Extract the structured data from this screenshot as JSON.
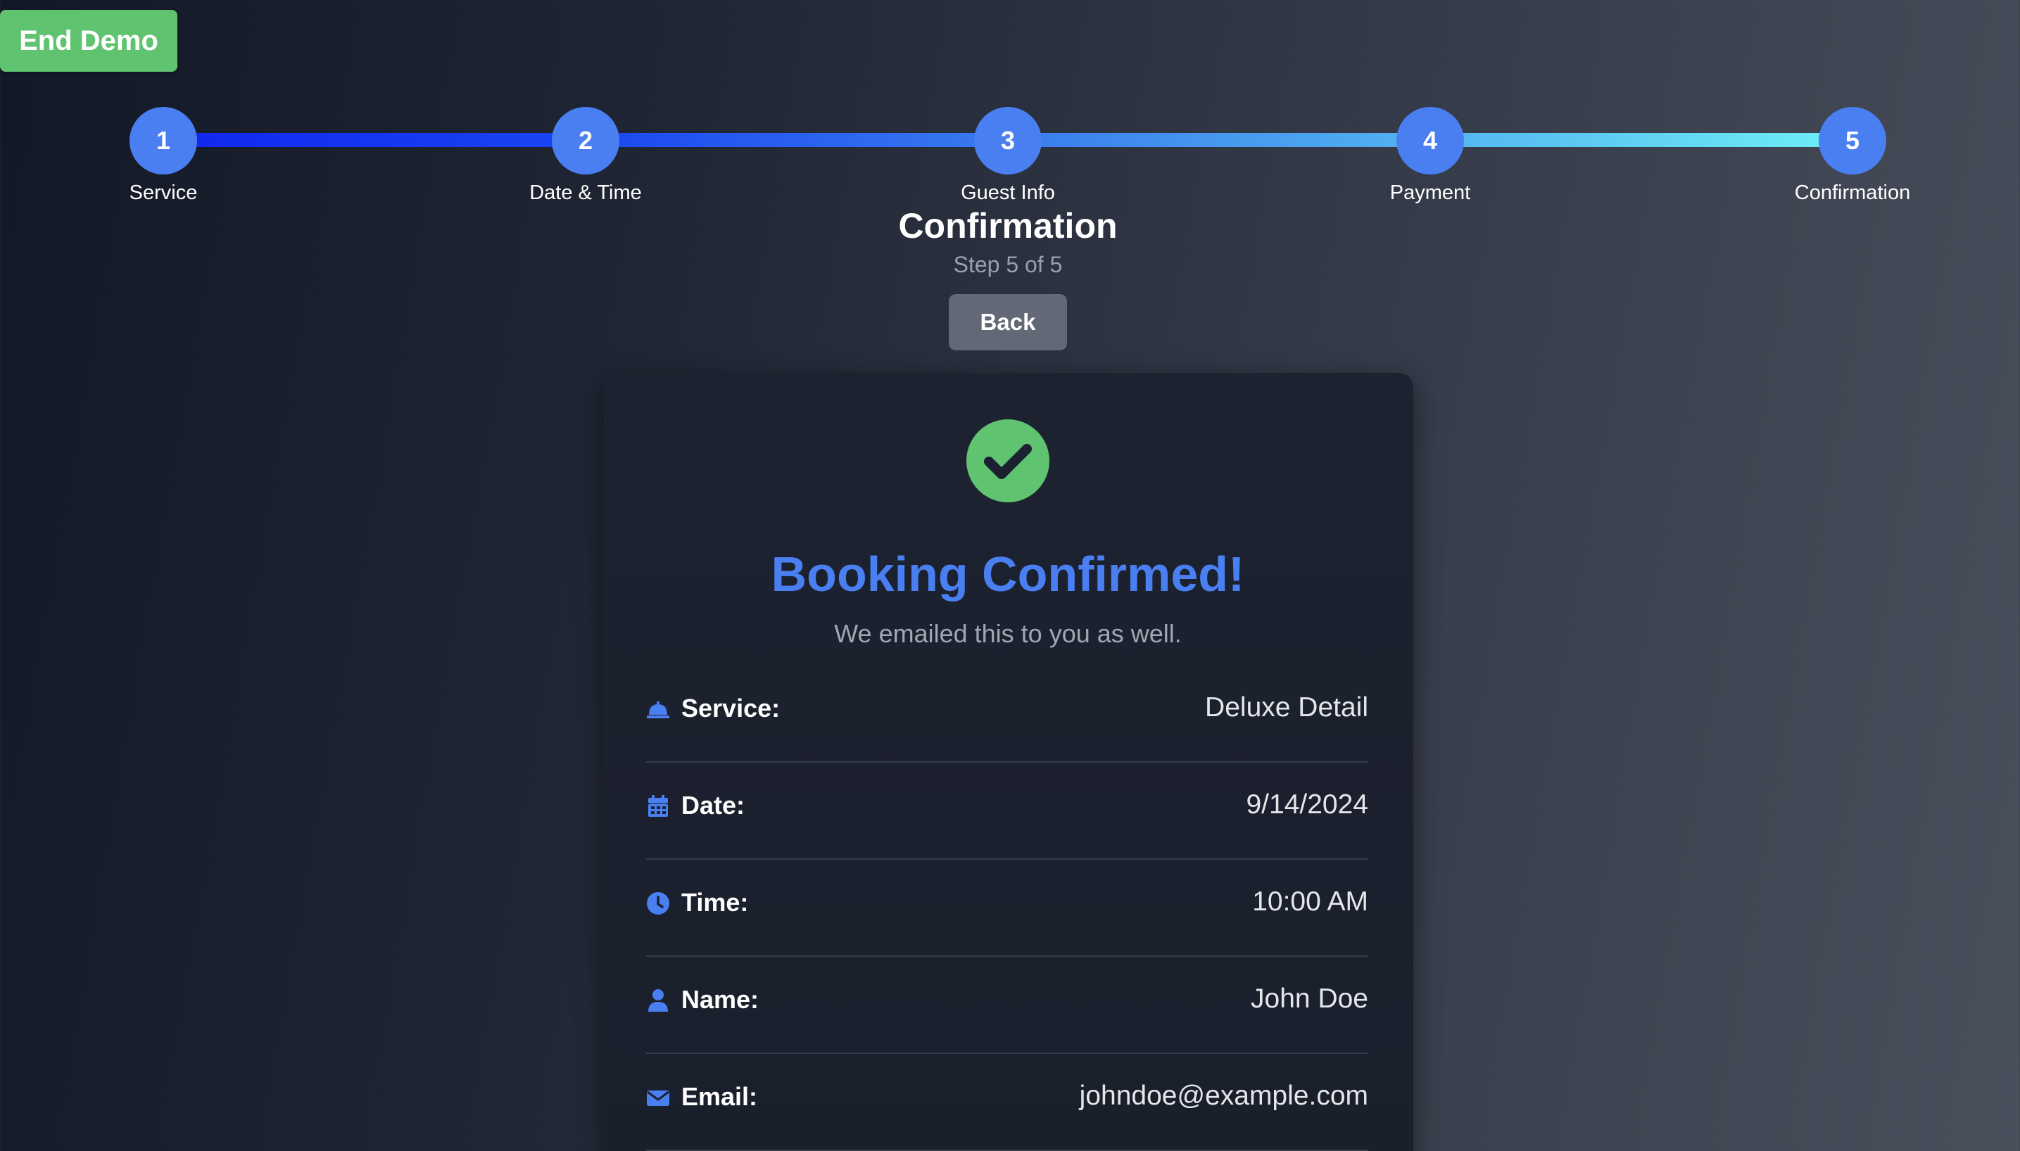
{
  "demo": {
    "end_label": "End Demo"
  },
  "stepper": {
    "steps": [
      {
        "number": "1",
        "label": "Service"
      },
      {
        "number": "2",
        "label": "Date & Time"
      },
      {
        "number": "3",
        "label": "Guest Info"
      },
      {
        "number": "4",
        "label": "Payment"
      },
      {
        "number": "5",
        "label": "Confirmation"
      }
    ],
    "current_step": 5,
    "total_steps": 5
  },
  "header": {
    "title": "Confirmation",
    "step_text": "Step 5 of 5",
    "back_label": "Back"
  },
  "confirmation": {
    "icon": "check-circle-icon",
    "title": "Booking Confirmed!",
    "subtitle": "We emailed this to you as well.",
    "details": [
      {
        "icon": "bell-icon",
        "label": "Service:",
        "value": "Deluxe Detail"
      },
      {
        "icon": "calendar-icon",
        "label": "Date:",
        "value": "9/14/2024"
      },
      {
        "icon": "clock-icon",
        "label": "Time:",
        "value": "10:00 AM"
      },
      {
        "icon": "user-icon",
        "label": "Name:",
        "value": "John Doe"
      },
      {
        "icon": "envelope-icon",
        "label": "Email:",
        "value": "johndoe@example.com"
      }
    ]
  },
  "colors": {
    "accent": "#4a7ff2",
    "success": "#5fc36f",
    "back_button": "#626875",
    "card": "#1d2230"
  }
}
